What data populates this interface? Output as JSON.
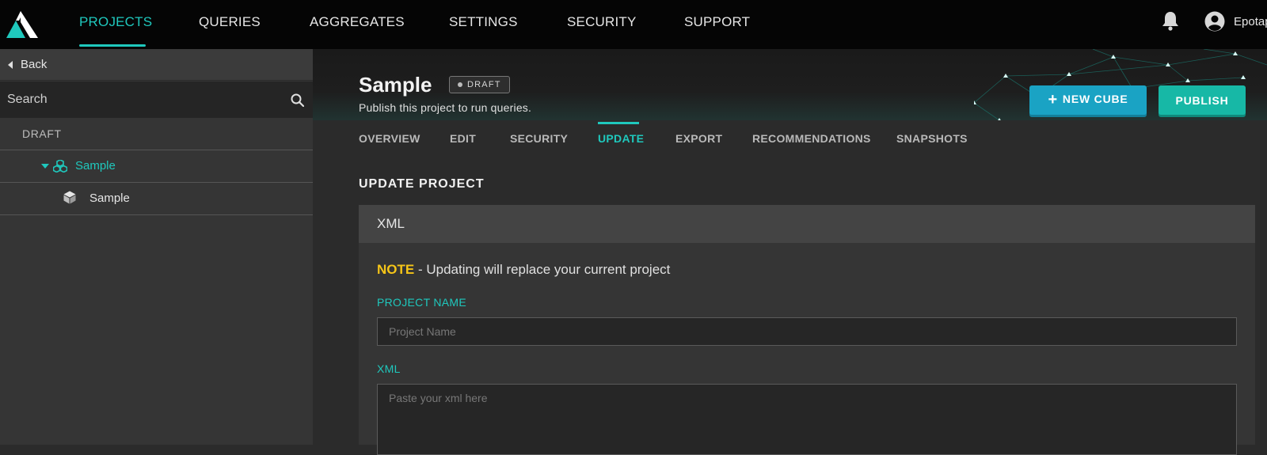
{
  "nav": {
    "items": [
      {
        "label": "PROJECTS",
        "active": true
      },
      {
        "label": "QUERIES",
        "active": false
      },
      {
        "label": "AGGREGATES",
        "active": false
      },
      {
        "label": "SETTINGS",
        "active": false
      },
      {
        "label": "SECURITY",
        "active": false
      },
      {
        "label": "SUPPORT",
        "active": false
      }
    ],
    "username": "Epotap",
    "icons": {
      "logo": "app-logo",
      "notifications": "bell-icon",
      "account": "user-circle-icon"
    }
  },
  "sidebar": {
    "back_label": "Back",
    "search_placeholder": "Search",
    "group_label": "DRAFT",
    "tree": [
      {
        "label": "Sample",
        "icon": "cubes-icon",
        "expanded": true,
        "selected": true
      },
      {
        "label": "Sample",
        "icon": "cube-icon",
        "expanded": false,
        "selected": false
      }
    ]
  },
  "header": {
    "title": "Sample",
    "badge": "DRAFT",
    "subtitle": "Publish this project to run queries.",
    "new_cube_label": "NEW CUBE",
    "publish_label": "PUBLISH"
  },
  "tabs": [
    {
      "label": "OVERVIEW",
      "active": false
    },
    {
      "label": "EDIT",
      "active": false
    },
    {
      "label": "SECURITY",
      "active": false
    },
    {
      "label": "UPDATE",
      "active": true
    },
    {
      "label": "EXPORT",
      "active": false
    },
    {
      "label": "RECOMMENDATIONS",
      "active": false
    },
    {
      "label": "SNAPSHOTS",
      "active": false
    }
  ],
  "update": {
    "section_title": "UPDATE PROJECT",
    "panel_title": "XML",
    "note_key": "NOTE",
    "note_text": " - Updating will replace your current project",
    "project_name_label": "PROJECT NAME",
    "project_name_placeholder": "Project Name",
    "xml_label": "XML",
    "xml_placeholder": "Paste your xml here"
  },
  "colors": {
    "accent": "#1fc8bd",
    "new_cube_button": "#1aa3c4",
    "publish_button": "#17b8a6",
    "note_highlight": "#f5c518",
    "topbar": "#050505"
  }
}
